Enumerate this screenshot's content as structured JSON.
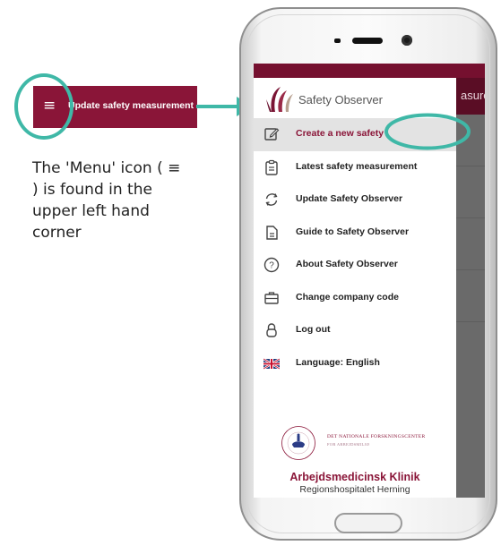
{
  "callout": {
    "toolbar_title": "Update safety measurement",
    "menu_glyph": "≡",
    "explanation": "The 'Menu' icon ( ≡ ) is found in the upper left hand corner"
  },
  "app": {
    "header_title_partial": "asure...",
    "brand": "Safety Observer",
    "menu": [
      {
        "label": "Create a new safety",
        "icon": "pencil-square-icon",
        "active": true
      },
      {
        "label": "Latest safety measurement",
        "icon": "clipboard-icon",
        "active": false
      },
      {
        "label": "Update Safety Observer",
        "icon": "refresh-icon",
        "active": false
      },
      {
        "label": "Guide to Safety Observer",
        "icon": "document-icon",
        "active": false
      },
      {
        "label": "About Safety Observer",
        "icon": "question-circle-icon",
        "active": false
      },
      {
        "label": "Change company code",
        "icon": "briefcase-icon",
        "active": false
      },
      {
        "label": "Log out",
        "icon": "padlock-icon",
        "active": false
      },
      {
        "label": "Language: English",
        "icon": "uk-flag-icon",
        "active": false
      }
    ],
    "footer": {
      "nfa_line1": "DET NATIONALE FORSKNINGSCENTER",
      "nfa_line2": "FOR ARBEJDSMILJØ",
      "seal_text": "FORSKNINGSCENTER FOR ARBEJDSMILJØ",
      "clinic_name": "Arbejdsmedicinsk Klinik",
      "hospital_name": "Regionshospitalet Herning"
    }
  },
  "colors": {
    "brand": "#8a1538",
    "highlight": "#3fb8a7",
    "active_item_bg": "#e3e3e3"
  }
}
